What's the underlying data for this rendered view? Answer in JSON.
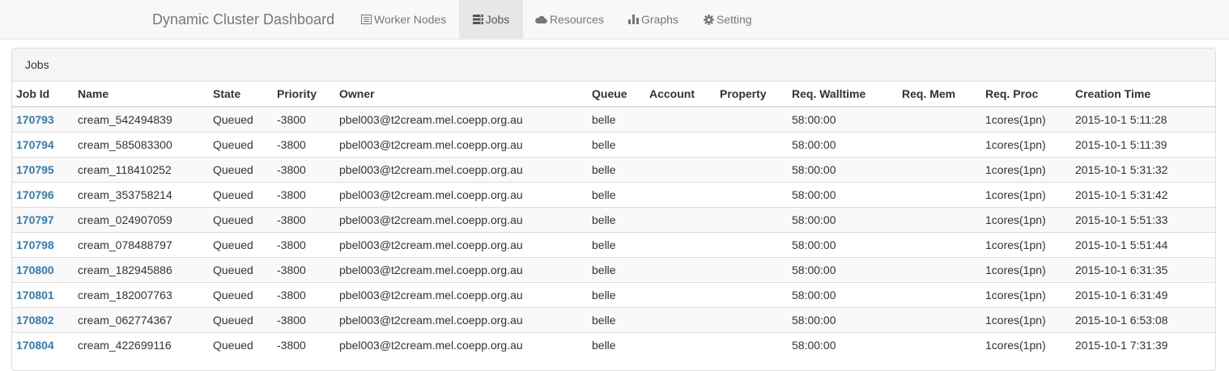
{
  "navbar": {
    "brand": "Dynamic Cluster Dashboard",
    "items": [
      {
        "label": "Worker Nodes",
        "icon": "list-icon",
        "active": false
      },
      {
        "label": "Jobs",
        "icon": "tasks-icon",
        "active": true
      },
      {
        "label": "Resources",
        "icon": "cloud-icon",
        "active": false
      },
      {
        "label": "Graphs",
        "icon": "bar-chart-icon",
        "active": false
      },
      {
        "label": "Setting",
        "icon": "gear-icon",
        "active": false
      }
    ]
  },
  "panel": {
    "title": "Jobs"
  },
  "table": {
    "columns": [
      "Job Id",
      "Name",
      "State",
      "Priority",
      "Owner",
      "Queue",
      "Account",
      "Property",
      "Req. Walltime",
      "Req. Mem",
      "Req. Proc",
      "Creation Time"
    ],
    "rows": [
      [
        "170793",
        "cream_542494839",
        "Queued",
        "-3800",
        "pbel003@t2cream.mel.coepp.org.au",
        "belle",
        "",
        "",
        "58:00:00",
        "",
        "1cores(1pn)",
        "2015-10-1 5:11:28"
      ],
      [
        "170794",
        "cream_585083300",
        "Queued",
        "-3800",
        "pbel003@t2cream.mel.coepp.org.au",
        "belle",
        "",
        "",
        "58:00:00",
        "",
        "1cores(1pn)",
        "2015-10-1 5:11:39"
      ],
      [
        "170795",
        "cream_118410252",
        "Queued",
        "-3800",
        "pbel003@t2cream.mel.coepp.org.au",
        "belle",
        "",
        "",
        "58:00:00",
        "",
        "1cores(1pn)",
        "2015-10-1 5:31:32"
      ],
      [
        "170796",
        "cream_353758214",
        "Queued",
        "-3800",
        "pbel003@t2cream.mel.coepp.org.au",
        "belle",
        "",
        "",
        "58:00:00",
        "",
        "1cores(1pn)",
        "2015-10-1 5:31:42"
      ],
      [
        "170797",
        "cream_024907059",
        "Queued",
        "-3800",
        "pbel003@t2cream.mel.coepp.org.au",
        "belle",
        "",
        "",
        "58:00:00",
        "",
        "1cores(1pn)",
        "2015-10-1 5:51:33"
      ],
      [
        "170798",
        "cream_078488797",
        "Queued",
        "-3800",
        "pbel003@t2cream.mel.coepp.org.au",
        "belle",
        "",
        "",
        "58:00:00",
        "",
        "1cores(1pn)",
        "2015-10-1 5:51:44"
      ],
      [
        "170800",
        "cream_182945886",
        "Queued",
        "-3800",
        "pbel003@t2cream.mel.coepp.org.au",
        "belle",
        "",
        "",
        "58:00:00",
        "",
        "1cores(1pn)",
        "2015-10-1 6:31:35"
      ],
      [
        "170801",
        "cream_182007763",
        "Queued",
        "-3800",
        "pbel003@t2cream.mel.coepp.org.au",
        "belle",
        "",
        "",
        "58:00:00",
        "",
        "1cores(1pn)",
        "2015-10-1 6:31:49"
      ],
      [
        "170802",
        "cream_062774367",
        "Queued",
        "-3800",
        "pbel003@t2cream.mel.coepp.org.au",
        "belle",
        "",
        "",
        "58:00:00",
        "",
        "1cores(1pn)",
        "2015-10-1 6:53:08"
      ],
      [
        "170804",
        "cream_422699116",
        "Queued",
        "-3800",
        "pbel003@t2cream.mel.coepp.org.au",
        "belle",
        "",
        "",
        "58:00:00",
        "",
        "1cores(1pn)",
        "2015-10-1 7:31:39"
      ]
    ]
  },
  "colors": {
    "link": "#337ab7",
    "navbar_bg": "#f8f8f8",
    "active_tab_bg": "#e7e7e7",
    "striped_row": "#f9f9f9"
  }
}
